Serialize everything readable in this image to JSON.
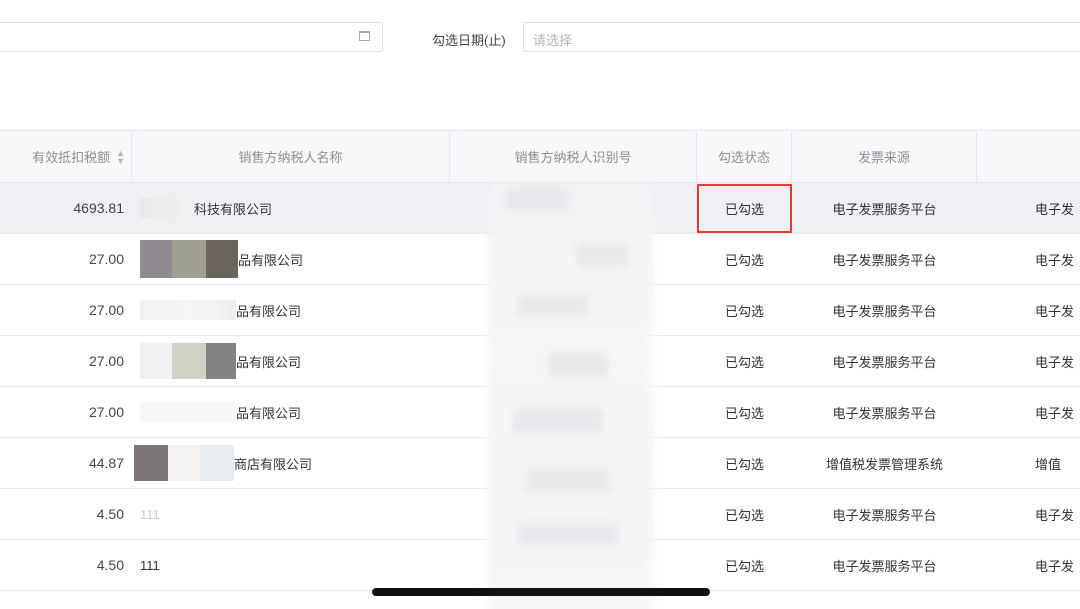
{
  "filters": {
    "check_date_label": "勾选日期(止)",
    "check_date_placeholder": "请选择"
  },
  "table": {
    "headers": {
      "amount": "有效抵扣税额",
      "seller_name": "销售方纳税人名称",
      "seller_id": "销售方纳税人识别号",
      "status": "勾选状态",
      "source": "发票来源"
    },
    "rows": [
      {
        "amount": "4693.81",
        "name_visible": "科技有限公司",
        "status": "已勾选",
        "source": "电子发票服务平台",
        "extra": "电子发"
      },
      {
        "amount": "27.00",
        "name_visible": "品有限公司",
        "status": "已勾选",
        "source": "电子发票服务平台",
        "extra": "电子发"
      },
      {
        "amount": "27.00",
        "name_visible": "品有限公司",
        "status": "已勾选",
        "source": "电子发票服务平台",
        "extra": "电子发"
      },
      {
        "amount": "27.00",
        "name_visible": "品有限公司",
        "status": "已勾选",
        "source": "电子发票服务平台",
        "extra": "电子发"
      },
      {
        "amount": "27.00",
        "name_visible": "品有限公司",
        "status": "已勾选",
        "source": "电子发票服务平台",
        "extra": "电子发"
      },
      {
        "amount": "44.87",
        "name_visible": "商店有限公司",
        "status": "已勾选",
        "source": "增值税发票管理系统",
        "extra": "增值"
      },
      {
        "amount": "4.50",
        "name_visible": "111",
        "status": "已勾选",
        "source": "电子发票服务平台",
        "extra": "电子发"
      },
      {
        "amount": "4.50",
        "name_visible": "111",
        "status": "已勾选",
        "source": "电子发票服务平台",
        "extra": "电子发"
      }
    ]
  },
  "colors": {
    "highlight_border": "#e53935",
    "header_bg": "#f7f8fa",
    "selected_row_bg": "#eef0f4"
  },
  "icons": {
    "date_picker": "calendar-icon",
    "sort": "sort-icon"
  }
}
